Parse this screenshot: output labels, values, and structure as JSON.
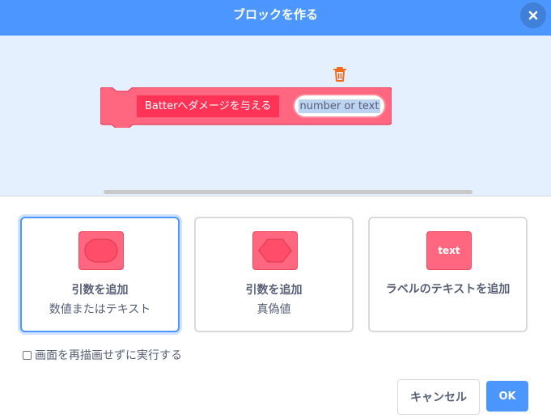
{
  "dialog": {
    "title": "ブロックを作る",
    "close_icon": "close-icon"
  },
  "block": {
    "label": "Batterへダメージを与える",
    "input_placeholder": "number or text",
    "delete_icon": "trash-icon",
    "color": "#ff6680"
  },
  "options": [
    {
      "title": "引数を追加",
      "subtitle": "数値またはテキスト",
      "icon": "oval-input-icon",
      "selected": true
    },
    {
      "title": "引数を追加",
      "subtitle": "真偽値",
      "icon": "hexagon-input-icon",
      "selected": false
    },
    {
      "title": "ラベルのテキストを追加",
      "subtitle": "",
      "icon": "text-label-icon",
      "icon_text": "text",
      "selected": false
    }
  ],
  "run_without_refresh": {
    "label": "画面を再描画せずに実行する",
    "checked": false
  },
  "footer": {
    "cancel_label": "キャンセル",
    "ok_label": "OK"
  },
  "colors": {
    "accent": "#4c97ff",
    "workspace": "#e5f0ff",
    "block_pink": "#ff6680",
    "block_red": "#ff3355"
  }
}
